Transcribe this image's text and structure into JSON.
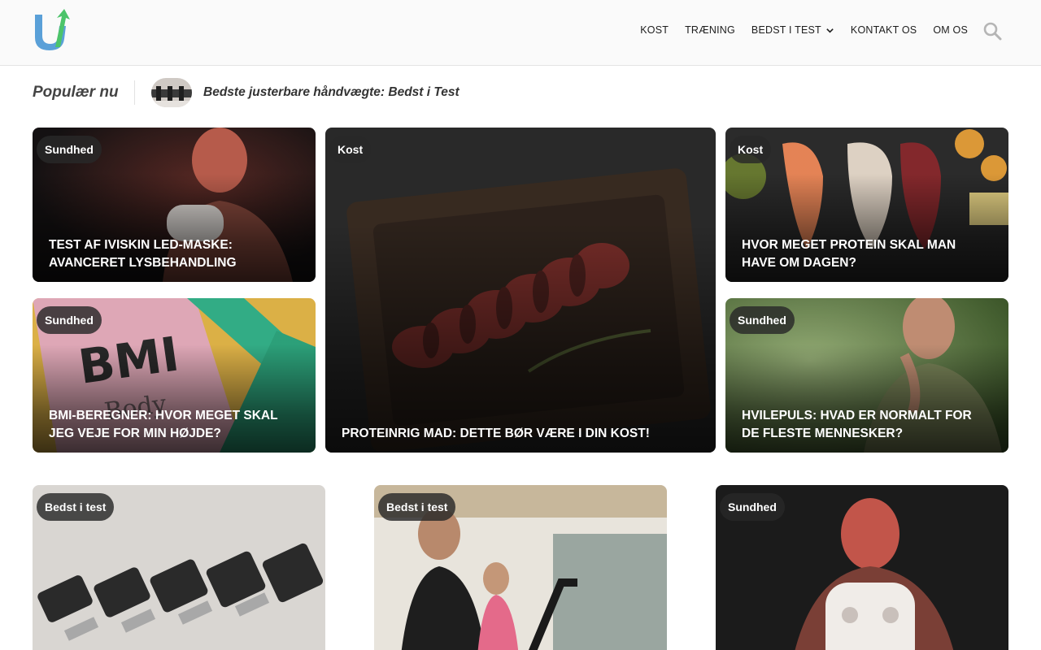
{
  "nav": {
    "items": [
      {
        "label": "KOST"
      },
      {
        "label": "TRÆNING"
      },
      {
        "label": "BEDST I TEST",
        "has_dropdown": true
      },
      {
        "label": "KONTAKT OS"
      },
      {
        "label": "OM OS"
      }
    ],
    "search_icon": "search-icon"
  },
  "popular": {
    "title": "Populær nu",
    "link": "Bedste justerbare håndvægte: Bedst i Test"
  },
  "featured": [
    {
      "badge": "Sundhed",
      "title": "TEST AF IVISKIN LED-MASKE: AVANCERET LYSBEHANDLING"
    },
    {
      "badge": "Sundhed",
      "title": "BMI-BEREGNER: HVOR MEGET SKAL JEG VEJE FOR MIN HØJDE?"
    },
    {
      "badge": "Kost",
      "title": "PROTEINRIG MAD: DETTE BØR VÆRE I DIN KOST!"
    },
    {
      "badge": "Kost",
      "title": "HVOR MEGET PROTEIN SKAL MAN HAVE OM DAGEN?"
    },
    {
      "badge": "Sundhed",
      "title": "HVILEPULS: HVAD ER NORMALT FOR DE FLESTE MENNESKER?"
    }
  ],
  "grid": [
    {
      "badge": "Bedst i test"
    },
    {
      "badge": "Bedst i test"
    },
    {
      "badge": "Sundhed"
    }
  ],
  "colors": {
    "logo_blue": "#5aa0d8",
    "logo_green": "#4cc46a",
    "badge_bg": "#2b2b2b"
  }
}
